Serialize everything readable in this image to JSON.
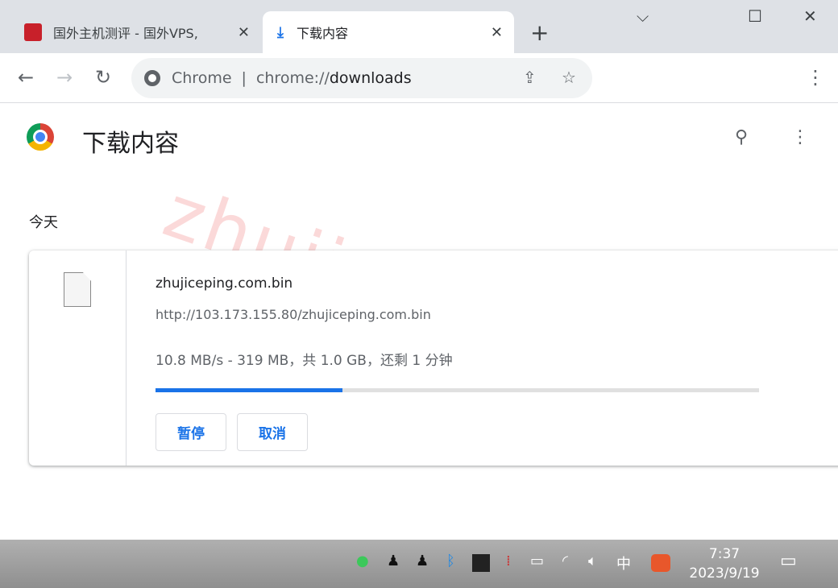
{
  "tabs": [
    {
      "title": "国外主机测评 - 国外VPS,",
      "icon": "site-favicon",
      "close": "✕"
    },
    {
      "title": "下载内容",
      "icon": "download-icon",
      "close": "✕"
    }
  ],
  "new_tab": "+",
  "window_controls": {
    "minimize": "⌵",
    "maximize": "☐",
    "close": "✕"
  },
  "nav": {
    "back": "←",
    "forward": "→",
    "reload": "↻"
  },
  "omnibox": {
    "site": "Chrome",
    "separator": "|",
    "url_scheme": "chrome://",
    "url_path": "downloads",
    "share": "⇪",
    "bookmark": "☆"
  },
  "menu": "⋮",
  "page": {
    "title": "下载内容",
    "search": "⚲",
    "more": "⋮",
    "section": "今天"
  },
  "watermark": "zhujiceping.com",
  "download": {
    "filename": "zhujiceping.com.bin",
    "url": "http://103.173.155.80/zhujiceping.com.bin",
    "status": "10.8 MB/s - 319 MB，共 1.0 GB，还剩 1 分钟",
    "progress": 0.31,
    "pause": "暂停",
    "cancel": "取消"
  },
  "colors": {
    "accent": "#1a73e8"
  },
  "taskbar": {
    "ime": "中",
    "time": "7:37",
    "date": "2023/9/19"
  }
}
